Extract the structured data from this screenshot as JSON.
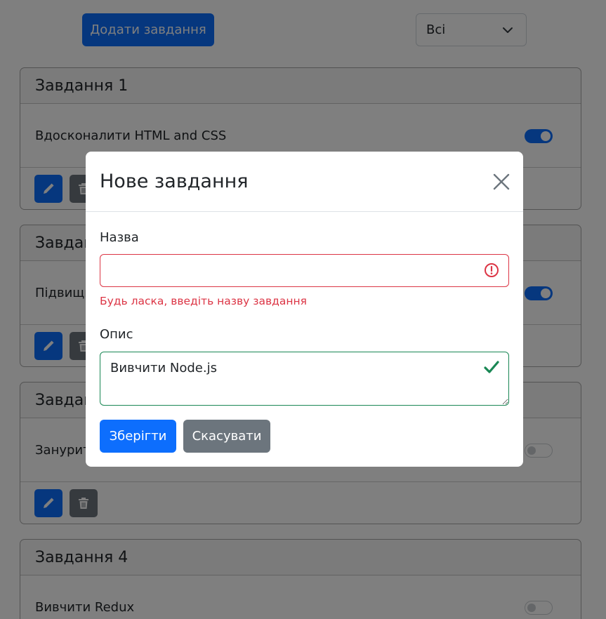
{
  "toolbar": {
    "add_label": "Додати завдання",
    "filter_value": "Всі"
  },
  "tasks": [
    {
      "title": "Завдання 1",
      "description": "Вдосконалити HTML and CSS",
      "completed": true
    },
    {
      "title": "Завдання 2",
      "description": "Підвищити",
      "completed": true
    },
    {
      "title": "Завдання 3",
      "description": "Занурити",
      "completed": false
    },
    {
      "title": "Завдання 4",
      "description": "Вивчити Redux",
      "completed": false
    }
  ],
  "modal": {
    "title": "Нове завдання",
    "name_label": "Назва",
    "name_value": "",
    "name_error": "Будь ласка, введіть назву завдання",
    "description_label": "Опис",
    "description_value": "Вивчити Node.js",
    "save_label": "Зберігти",
    "cancel_label": "Скасувати"
  },
  "colors": {
    "primary": "#0d6efd",
    "secondary": "#6c757d",
    "danger": "#dc3545",
    "success": "#198754"
  },
  "icons": {
    "edit": "pencil-icon",
    "delete": "trash-icon",
    "close": "close-icon",
    "invalid": "exclamation-circle-icon",
    "valid": "check-icon",
    "filter": "chevron-down-icon"
  }
}
